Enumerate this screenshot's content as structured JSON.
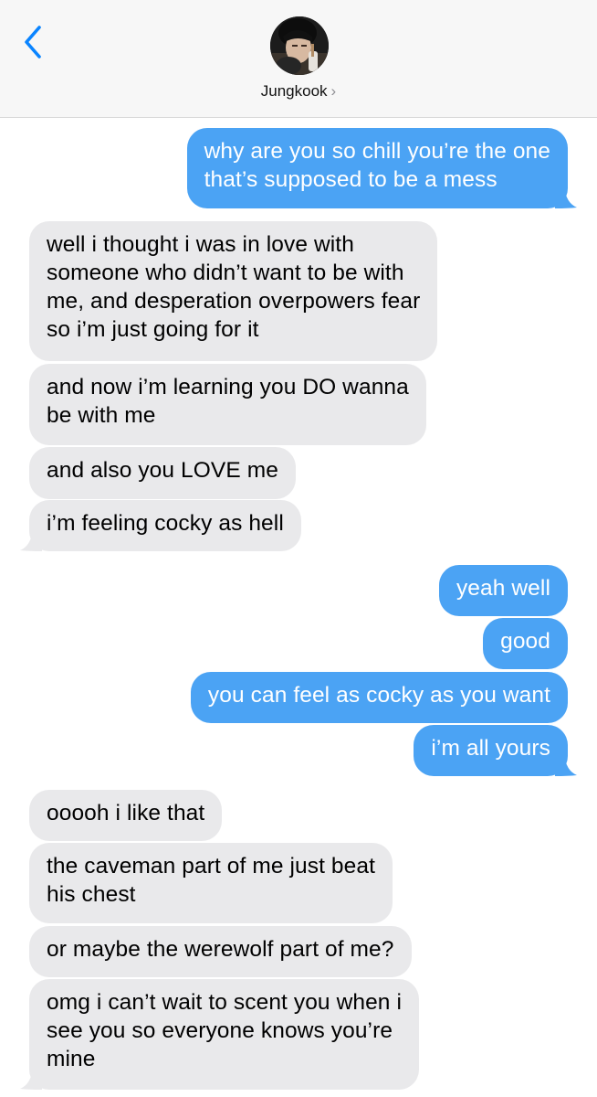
{
  "header": {
    "contact_name": "Jungkook",
    "chevron": "›",
    "back_icon": "chevron-left-icon",
    "accent": "#0a84ff"
  },
  "colors": {
    "outgoing": "#4ba3f4",
    "incoming": "#e9e9eb"
  },
  "messages": [
    {
      "dir": "out",
      "text": "why are you so chill you’re the one\nthat’s supposed to be a mess"
    },
    {
      "dir": "in",
      "text": "well i thought i was in love with\nsomeone who didn’t want to be with\nme, and desperation overpowers fear\nso i’m just going for it"
    },
    {
      "dir": "in",
      "text": "and now i’m learning you DO wanna\nbe with me"
    },
    {
      "dir": "in",
      "text": "and also you LOVE me"
    },
    {
      "dir": "in",
      "text": "i’m feeling cocky as hell"
    },
    {
      "dir": "out",
      "text": "yeah well"
    },
    {
      "dir": "out",
      "text": "good"
    },
    {
      "dir": "out",
      "text": "you can feel as cocky as you want"
    },
    {
      "dir": "out",
      "text": "i’m all yours"
    },
    {
      "dir": "in",
      "text": "ooooh i like that"
    },
    {
      "dir": "in",
      "text": "the caveman part of me just beat\nhis chest"
    },
    {
      "dir": "in",
      "text": "or maybe the werewolf part of me?"
    },
    {
      "dir": "in",
      "text": "omg i can’t wait to scent you when i\nsee you so everyone knows you’re\nmine"
    }
  ]
}
